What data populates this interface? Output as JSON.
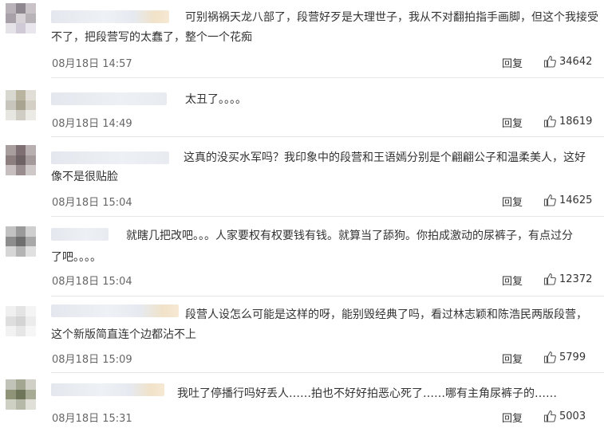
{
  "comments": [
    {
      "line1": "可别祸祸天龙八部了，段营好歹是大理世子，我从不对翻拍指手画脚，但这个我接受",
      "line2": "不了，把段营写的太蠢了，整个一个花痴",
      "date": "08月18日 14:57",
      "reply": "回复",
      "likes": "34642"
    },
    {
      "line1": "太丑了。。。。",
      "line2": "",
      "date": "08月18日 14:49",
      "reply": "回复",
      "likes": "18619"
    },
    {
      "line1": "这真的没买水军吗？我印象中的段营和王语嫣分别是个翩翩公子和温柔美人，这好",
      "line2": "像不是很贴脸",
      "date": "08月18日 15:04",
      "reply": "回复",
      "likes": "14625"
    },
    {
      "line1": "就瞎几把改吧。。。人家要权有权要钱有钱。就算当了舔狗。你拍成激动的尿裤子，有点过分",
      "line2": "了吧。。。。",
      "date": "08月18日 15:04",
      "reply": "回复",
      "likes": "12372"
    },
    {
      "line1": "段营人设怎么可能是这样的呀，能别毁经典了吗，看过林志颖和陈浩民两版段营，",
      "line2": "这个新版简直连个边都沾不上",
      "date": "08月18日 15:09",
      "reply": "回复",
      "likes": "5799"
    },
    {
      "line1": "我吐了停播行吗好丢人……拍也不好好拍恶心死了……哪有主角尿裤子的……",
      "line2": "",
      "date": "08月18日 15:31",
      "reply": "回复",
      "likes": "5003"
    }
  ],
  "icons": {
    "like": "thumbs-up-icon"
  },
  "colors": {
    "text": "#333333",
    "date": "#666666",
    "divider": "#e6e6e6"
  }
}
